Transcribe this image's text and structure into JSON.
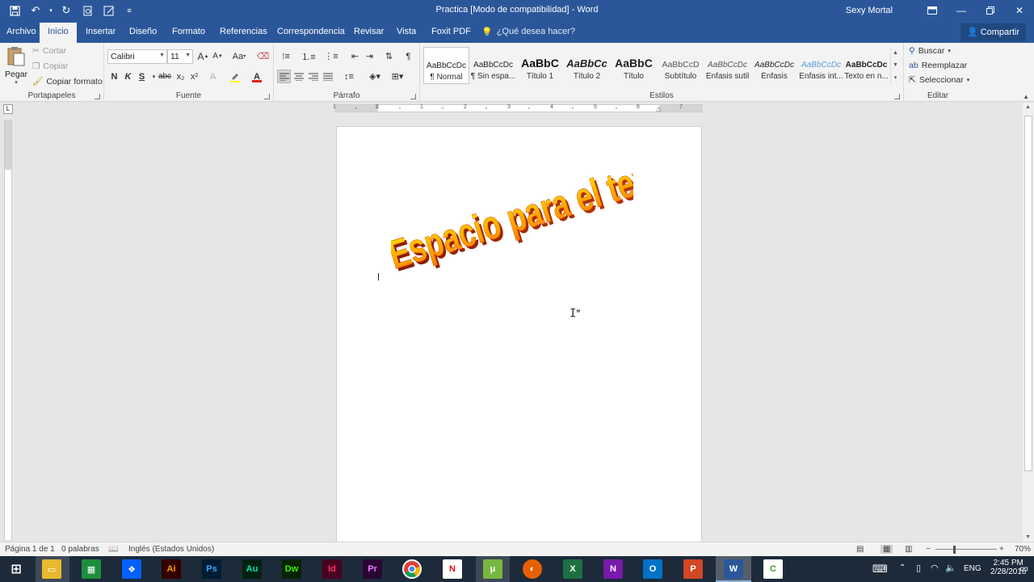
{
  "window": {
    "title": "Practica [Modo de compatibilidad] - Word",
    "user": "Sexy Mortal",
    "share": "Compartir"
  },
  "tabs": [
    {
      "label": "Archivo"
    },
    {
      "label": "Inicio"
    },
    {
      "label": "Insertar"
    },
    {
      "label": "Diseño"
    },
    {
      "label": "Formato"
    },
    {
      "label": "Referencias"
    },
    {
      "label": "Correspondencia"
    },
    {
      "label": "Revisar"
    },
    {
      "label": "Vista"
    },
    {
      "label": "Foxit PDF"
    }
  ],
  "tell_me": "¿Qué desea hacer?",
  "clipboard": {
    "paste": "Pegar",
    "cut": "Cortar",
    "copy": "Copiar",
    "format_painter": "Copiar formato",
    "label": "Portapapeles"
  },
  "font": {
    "name": "Calibri",
    "size": "11",
    "label": "Fuente",
    "bold": "N",
    "italic": "K",
    "underline": "S",
    "strike": "abc",
    "sub": "x₂",
    "sup": "x²",
    "grow": "A",
    "shrink": "A",
    "case": "Aa"
  },
  "paragraph": {
    "label": "Párrafo"
  },
  "styles": {
    "label": "Estilos",
    "items": [
      {
        "preview": "AaBbCcDc",
        "name": "¶ Normal"
      },
      {
        "preview": "AaBbCcDc",
        "name": "¶ Sin espa..."
      },
      {
        "preview": "AaBbC",
        "name": "Título 1"
      },
      {
        "preview": "AaBbCc",
        "name": "Título 2"
      },
      {
        "preview": "AaBbC",
        "name": "Título"
      },
      {
        "preview": "AaBbCcD",
        "name": "Subtítulo"
      },
      {
        "preview": "AaBbCcDc",
        "name": "Énfasis sutil"
      },
      {
        "preview": "AaBbCcDc",
        "name": "Énfasis"
      },
      {
        "preview": "AaBbCcDc",
        "name": "Énfasis int..."
      },
      {
        "preview": "AaBbCcDc",
        "name": "Texto en n..."
      }
    ]
  },
  "editing": {
    "find": "Buscar",
    "replace": "Reemplazar",
    "select": "Seleccionar",
    "label": "Editar"
  },
  "ruler_numbers": [
    "1",
    "1",
    "2",
    "3",
    "4",
    "5",
    "6",
    "7"
  ],
  "document": {
    "wordart": "Espacio para el texto"
  },
  "status": {
    "page": "Página 1 de 1",
    "words": "0 palabras",
    "language": "Inglés (Estados Unidos)",
    "zoom": "70%"
  },
  "tray": {
    "lang": "ENG",
    "time": "2:45 PM",
    "date": "2/28/2016"
  },
  "colors": {
    "word_blue": "#2b579a",
    "taskbar": "#1d2a3a"
  }
}
